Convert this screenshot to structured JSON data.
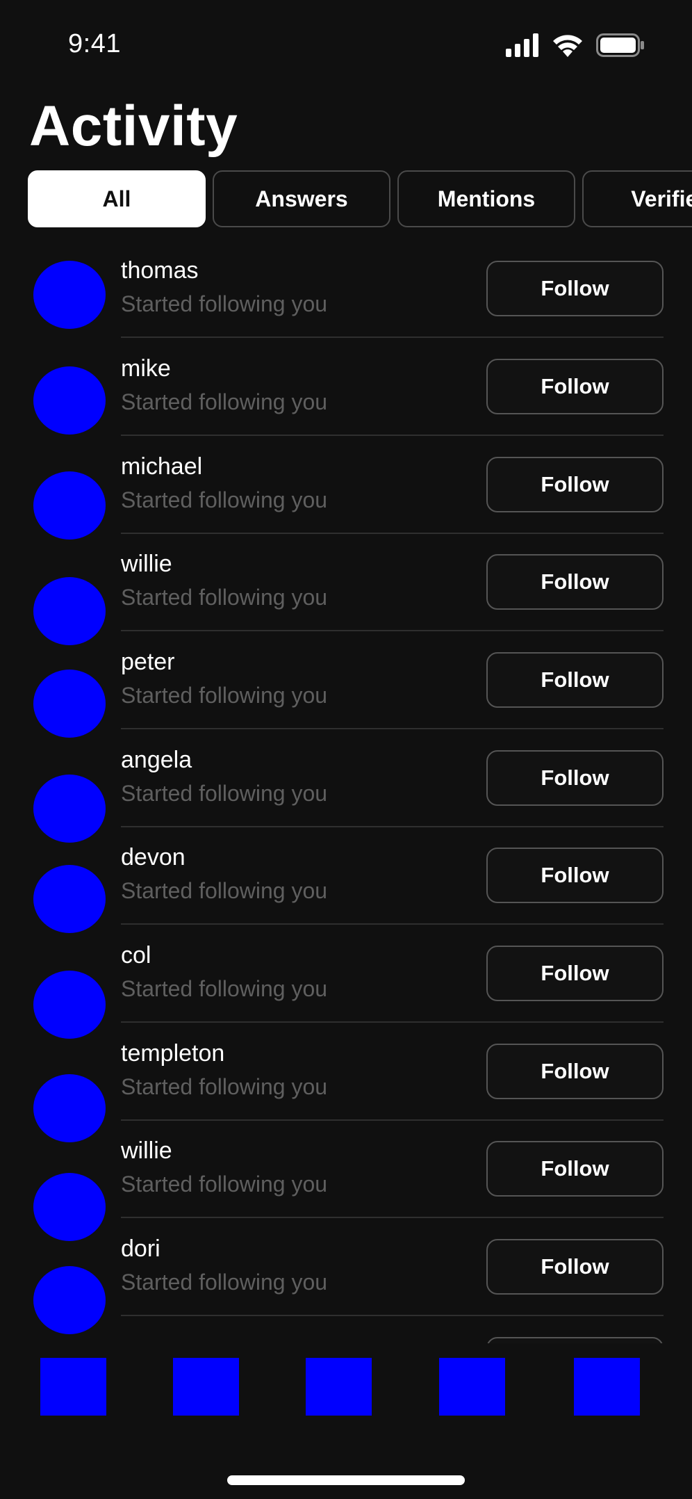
{
  "status_bar": {
    "time": "9:41",
    "icons": [
      "signal-icon",
      "wifi-icon",
      "battery-icon"
    ]
  },
  "title": "Activity",
  "tabs": [
    {
      "label": "All",
      "active": true
    },
    {
      "label": "Answers",
      "active": false
    },
    {
      "label": "Mentions",
      "active": false
    },
    {
      "label": "Verified",
      "active": false
    }
  ],
  "activity": [
    {
      "username": "thomas",
      "subtitle": "Started following you",
      "button": "Follow"
    },
    {
      "username": "mike",
      "subtitle": "Started following you",
      "button": "Follow"
    },
    {
      "username": "michael",
      "subtitle": "Started following you",
      "button": "Follow"
    },
    {
      "username": "willie",
      "subtitle": "Started following you",
      "button": "Follow"
    },
    {
      "username": "peter",
      "subtitle": "Started following you",
      "button": "Follow"
    },
    {
      "username": "angela",
      "subtitle": "Started following you",
      "button": "Follow"
    },
    {
      "username": "devon",
      "subtitle": "Started following you",
      "button": "Follow"
    },
    {
      "username": "col",
      "subtitle": "Started following you",
      "button": "Follow"
    },
    {
      "username": "templeton",
      "subtitle": "Started following you",
      "button": "Follow"
    },
    {
      "username": "willie",
      "subtitle": "Started following you",
      "button": "Follow"
    },
    {
      "username": "dori",
      "subtitle": "Started following you",
      "button": "Follow"
    },
    {
      "username": "",
      "subtitle": "",
      "button": ""
    }
  ],
  "tab_bar": {
    "items": [
      "tab-bar-item-1",
      "tab-bar-item-2",
      "tab-bar-item-3",
      "tab-bar-item-4",
      "tab-bar-item-5"
    ]
  },
  "colors": {
    "background": "#101010",
    "placeholder": "#0000ff",
    "secondary_text": "#5f5f5f"
  }
}
